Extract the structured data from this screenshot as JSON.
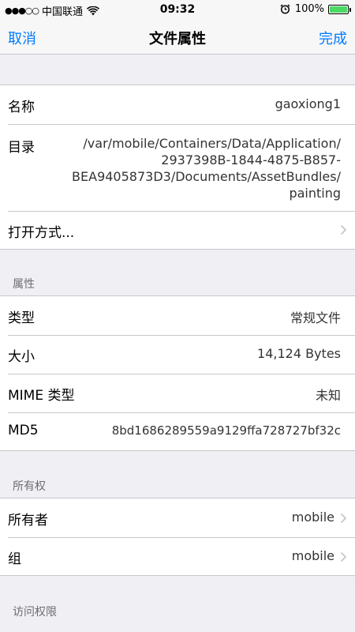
{
  "status_bar": {
    "signal": "●●●○○",
    "carrier": "中国联通",
    "time": "09:32",
    "battery_percent": "100%",
    "battery_level": 1.0,
    "wifi_icon": "wifi-icon",
    "alarm_icon": "alarm-clock-icon"
  },
  "nav": {
    "cancel": "取消",
    "title": "文件属性",
    "done": "完成"
  },
  "file": {
    "name_label": "名称",
    "name_value": "gaoxiong1",
    "dir_label": "目录",
    "dir_value_lines": [
      "/var/mobile/Containers/Data/Application/",
      "2937398B-1844-4875-B857-",
      "BEA9405873D3/Documents/AssetBundles/",
      "painting"
    ],
    "open_with_label": "打开方式..."
  },
  "properties": {
    "header": "属性",
    "rows": [
      {
        "label": "类型",
        "value": "常规文件"
      },
      {
        "label": "大小",
        "value": "14,124 Bytes"
      },
      {
        "label": "MIME 类型",
        "value": "未知"
      },
      {
        "label": "MD5",
        "value": "8bd1686289559a9129ffa728727bf32c"
      }
    ]
  },
  "ownership": {
    "header": "所有权",
    "owner_label": "所有者",
    "owner_value": "mobile",
    "group_label": "组",
    "group_value": "mobile"
  },
  "access": {
    "header": "访问权限"
  },
  "colors": {
    "accent": "#007aff",
    "background": "#efeff4",
    "separator": "#c8c7cc",
    "battery": "#4cd964"
  }
}
